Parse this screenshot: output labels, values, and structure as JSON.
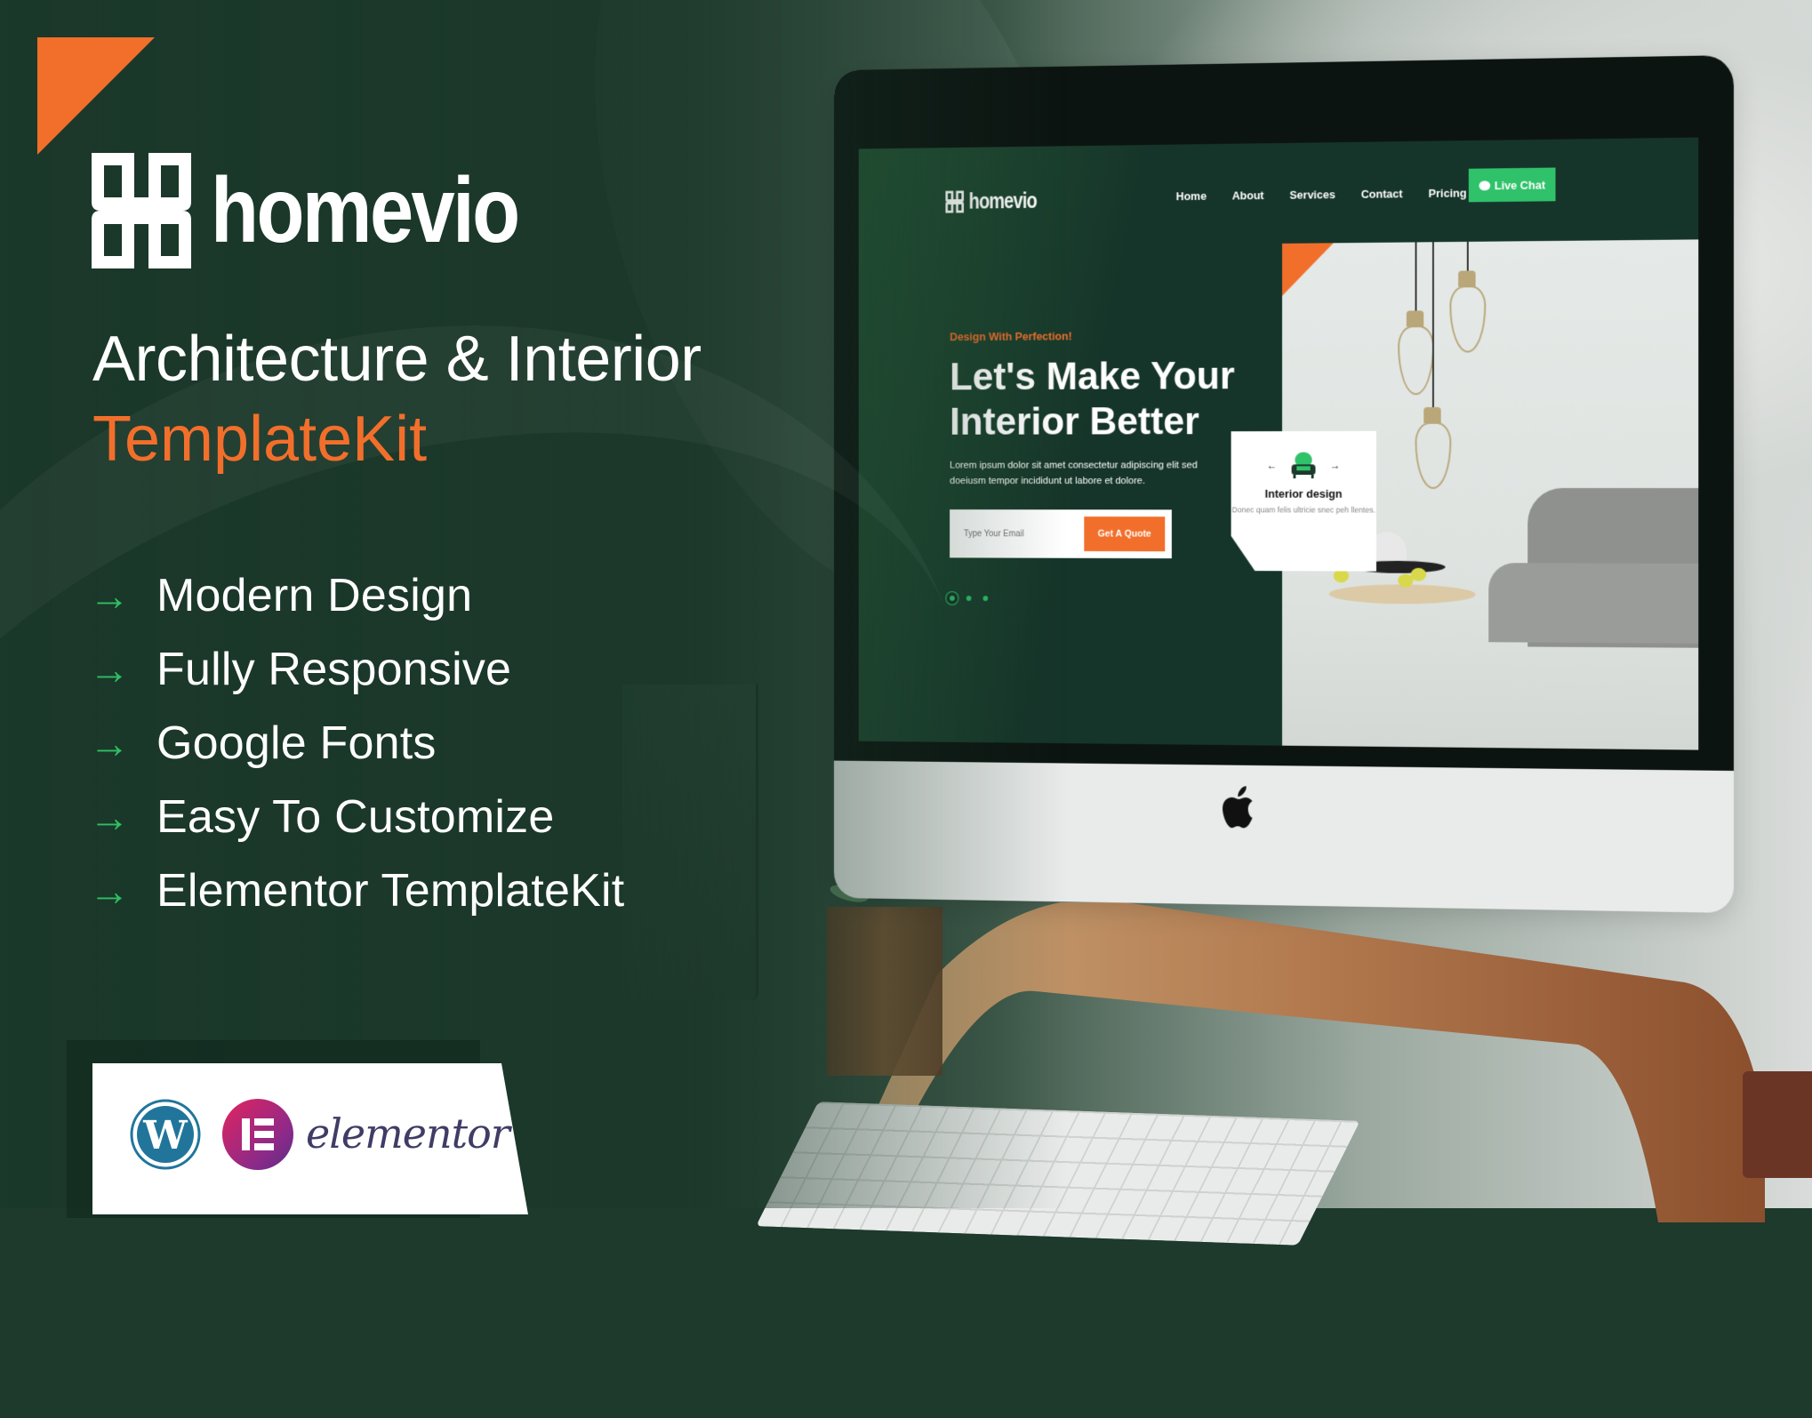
{
  "hero": {
    "brand_name": "homevio",
    "headline_line1": "Architecture & Interior",
    "headline_line2": "TemplateKit",
    "features": [
      {
        "icon": "arrow-right-icon",
        "label": "Modern Design"
      },
      {
        "icon": "arrow-right-icon",
        "label": "Fully Responsive"
      },
      {
        "icon": "arrow-right-icon",
        "label": "Google Fonts"
      },
      {
        "icon": "arrow-right-icon",
        "label": "Easy To Customize"
      },
      {
        "icon": "arrow-right-icon",
        "label": "Elementor TemplateKit"
      }
    ],
    "arrow_glyph": "→",
    "badges": {
      "wordpress": "wordpress-logo",
      "elementor": "elementor-logo",
      "elementor_word": "elementor"
    }
  },
  "screen": {
    "brand_name": "homevio",
    "nav": [
      "Home",
      "About",
      "Services",
      "Contact",
      "Pricing"
    ],
    "cta_label": "Live Chat",
    "tagline": "Design With Perfection!",
    "title": "Let's Make Your Interior Better",
    "description": "Lorem ipsum dolor sit amet consectetur adipiscing elit sed doeiusm tempor incididunt ut labore et dolore.",
    "email_placeholder": "Type Your Email",
    "quote_button": "Get A Quote",
    "slider_dots": 3,
    "active_dot": 1,
    "card": {
      "title": "Interior design",
      "text": "Donec quam felis ultricie snec peh llentes.",
      "prev": "←",
      "next": "→"
    }
  },
  "colors": {
    "brand_green": "#1d3a2c",
    "accent_orange": "#f26f2b",
    "accent_green": "#2fc26a"
  }
}
